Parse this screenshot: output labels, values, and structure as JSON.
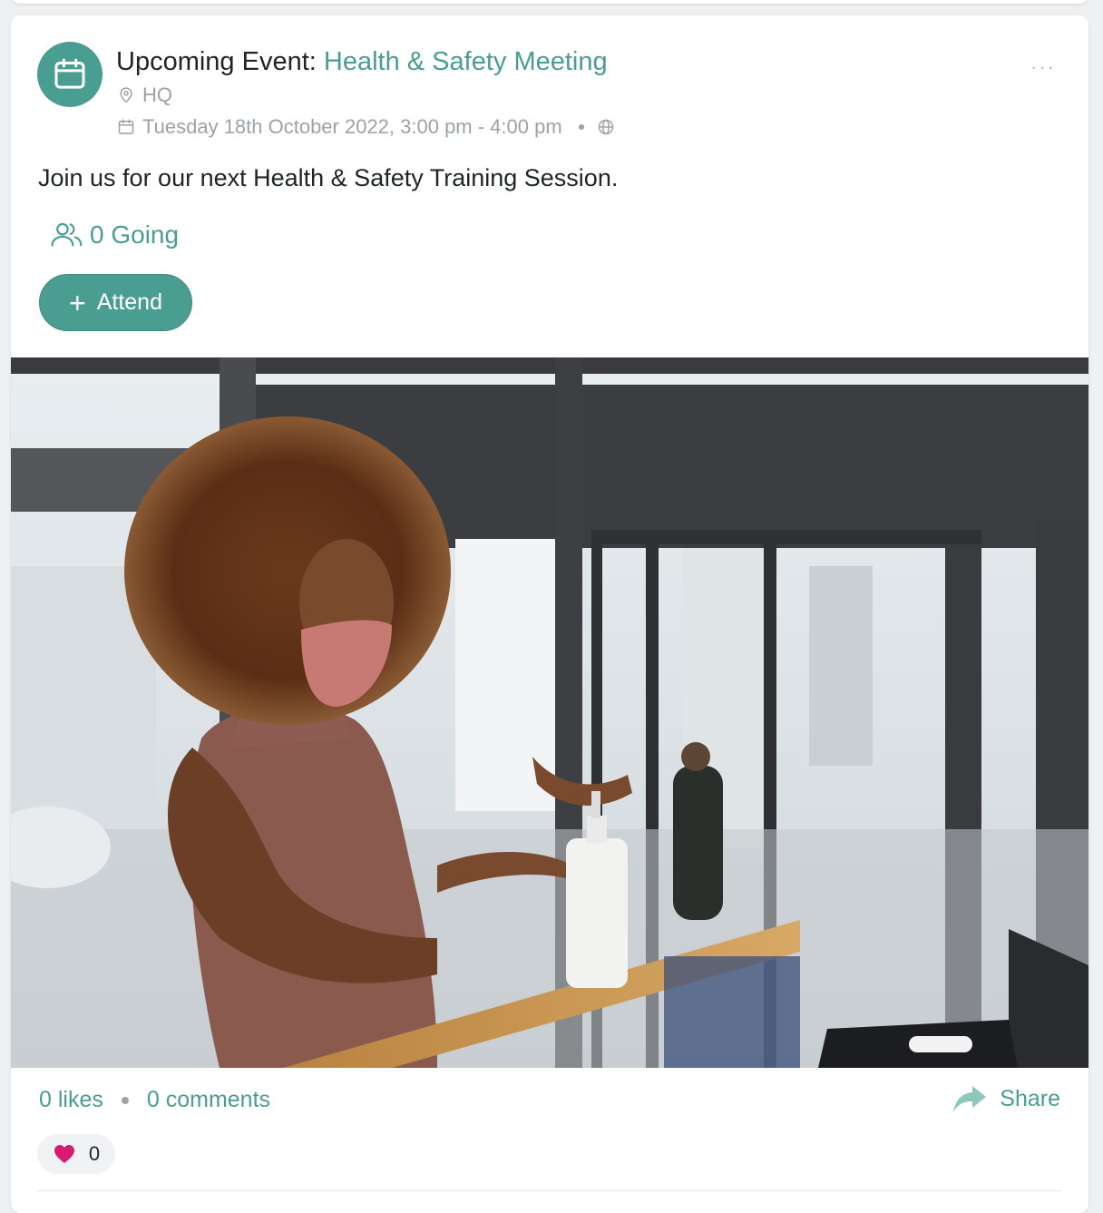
{
  "event": {
    "title_prefix": "Upcoming Event:",
    "title_name": "Health & Safety Meeting",
    "location": "HQ",
    "datetime": "Tuesday 18th October 2022, 3:00 pm - 4:00 pm",
    "description": "Join us for our next Health & Safety Training Session.",
    "going": "0 Going",
    "attend_label": "Attend",
    "more_label": "···"
  },
  "footer": {
    "likes": "0 likes",
    "comments": "0 comments",
    "share_label": "Share",
    "reaction_count": "0"
  },
  "icons": {
    "avatar": "calendar-icon",
    "location": "map-pin-icon",
    "date": "calendar-icon",
    "visibility": "globe-icon",
    "going": "users-icon",
    "attend": "plus-icon",
    "share": "share-arrow-icon",
    "reaction": "heart-icon"
  },
  "colors": {
    "accent": "#4a9e91",
    "muted": "#9aa3a9",
    "heart": "#d81b72"
  }
}
